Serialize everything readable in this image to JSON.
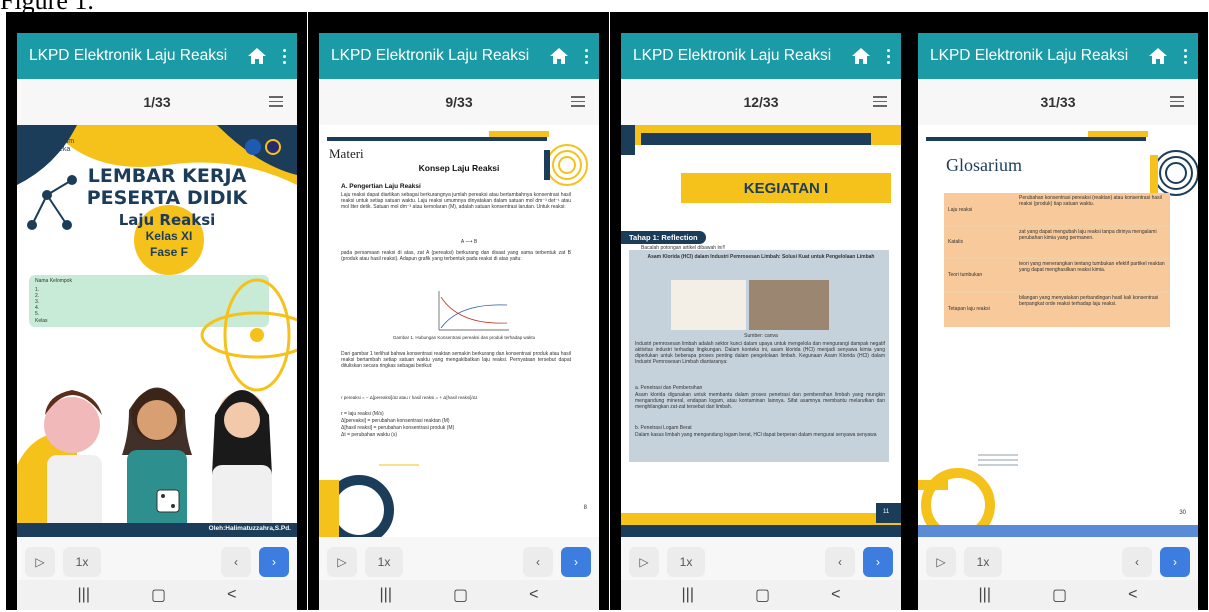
{
  "figure_label": "Figure 1.",
  "app": {
    "title": "LKPD Elektronik Laju Reaksi"
  },
  "controls": {
    "speed": "1x"
  },
  "screens": [
    {
      "page_indicator": "1/33",
      "cover": {
        "kurikulum": "Kurikulum",
        "merdeka": "Merdeka",
        "title_line1": "LEMBAR KERJA",
        "title_line2": "PESERTA DIDIK",
        "subtitle": "Laju Reaksi",
        "kelas": "Kelas XI",
        "fase": "Fase F",
        "form_label": "Nama Kelompok",
        "form_lines": [
          "1.",
          "2.",
          "3.",
          "4.",
          "5."
        ],
        "kelas_label": "Kelas",
        "author": "Oleh:Halimatuzzahra,S.Pd."
      }
    },
    {
      "page_indicator": "9/33",
      "materi": {
        "section": "Materi",
        "title": "Konsep Laju Reaksi",
        "sub_a": "A. Pengertian Laju Reaksi",
        "para1": "Laju reaksi dapat diartikan sebagai berkurangnya jumlah pereaksi atau bertambahnya konsentrasi hasil reaksi untuk setiap satuan waktu. Laju reaksi umumnya dinyatakan dalam satuan mol dm⁻³ det⁻¹ atau mol liter detik. Satuan mol dm⁻³ atau kemolaran (M), adalah satuan konsentrasi larutan. Untuk reaksi:",
        "equation": "A  ⟶  B",
        "para2": "pada persamaan reaksi di atas, zat A (pereaksi) berkurang dan disaat yang sama terbentuk zat B (produk atau hasil reaksi). Adapun grafik yang terbentuk pada reaksi di atas yaitu:",
        "graph_caption": "Gambar 1. Hubungan Konsentrasi pereaksi dan produk terhadap waktu",
        "para3": "Dari gambar 1 terlihat bahwa konsentrasi reaktan semakin berkurang dan konsentrasi produk atau hasil reaksi bertambah setiap satuan waktu yang mengakibatkan laju reaksi. Pernyataan tersebut dapat dituliskan secara ringkas sebagai berikut:",
        "rate_equation": "r pereaksi = − Δ[pereaksi]/Δt   atau   r hasil reaksi = + Δ[hasil reaksi]/Δt",
        "defs": [
          "r   = laju reaksi (M/s)",
          "Δ[pereaksi]  = perubahan konsentrasi reaktan (M)",
          "Δ[hasil reaksi]  = perubahan konsentrasi produk (M)",
          "Δt  = perubahan waktu (s)"
        ],
        "page_number": "8"
      }
    },
    {
      "page_indicator": "12/33",
      "kegiatan": {
        "banner": "KEGIATAN I",
        "tahap": "Tahap 1: Reflection",
        "instruction": "Bacalah potongan artikel dibawah ini!!",
        "article_title": "Asam Klorida (HCl) dalam Industri Pemrosesan Limbah: Solusi Kuat untuk Pengelolaan Limbah",
        "source": "Sumber: canva",
        "body1": "Industri pemrosesan limbah adalah sektor kunci dalam upaya untuk mengelola dan mengurangi dampak negatif aktivitas industri terhadap lingkungan. Dalam konteks ini, asam klorida (HCl) menjadi senyawa kimia yang diperlukan untuk beberapa proses penting dalam pengelolaan limbah. Kegunaan Asam Klorida (HCl) dalam Industri Pemrosesan Limbah diantaranya:",
        "item_a": "a. Penetrasi dan Pembersihan",
        "body2": "Asam klorida digunakan untuk membantu dalam proses penetrasi dan pembersihan limbah yang mungkin mengandung mineral, endapan logam, atau kontaminan lainnya. Sifat asamnya membantu melarutkan dan menghilangkan zat-zat tersebut dari limbah.",
        "item_b": "b. Penetrasi Logam Berat",
        "body3": "Dalam kasus limbah yang mengandung logam berat, HCl dapat berperan dalam mengurai senyawa senyawa",
        "page_number": "11"
      }
    },
    {
      "page_indicator": "31/33",
      "glosarium": {
        "title": "Glosarium",
        "rows": [
          {
            "term": "Laju reaksi",
            "def": "Perubahan konsentrasi pereaksi (reaktan) atau konsentrasi hasil reaksi (produk) tiap satuan waktu."
          },
          {
            "term": "Katalis",
            "def": "zat yang dapat mengubah laju reaksi tanpa dirinya mengalami perubahan kimia yang permanen."
          },
          {
            "term": "Teori tumbukan",
            "def": "teori yang menerangkan tentang tumbukan efektif partikel reaktan yang dapat menghasilkan reaksi kimia."
          },
          {
            "term": "Tetapan laju reaksi",
            "def": "bilangan yang menyatakan perbandingan hasil kali konsentrasi berpangkat orde reaksi terhadap laju reaksi."
          }
        ],
        "page_number": "30"
      }
    }
  ],
  "colors": {
    "appbar": "#1a9ba5",
    "next_button": "#3e7de0",
    "yellow": "#f5c21b",
    "navy": "#1c3d5a",
    "glossary_fill": "#f8c99a"
  }
}
